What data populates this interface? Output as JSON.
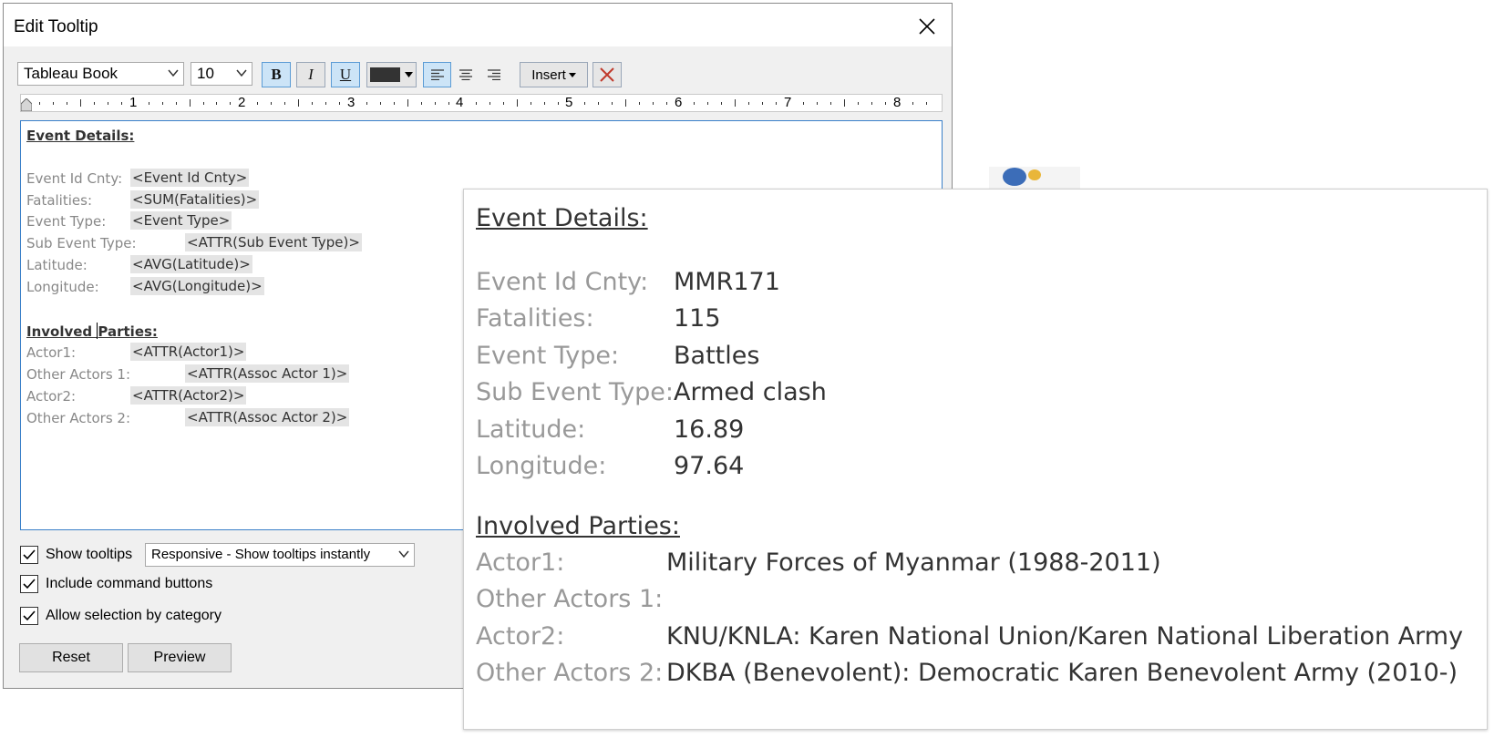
{
  "dialog": {
    "title": "Edit Tooltip",
    "toolbar": {
      "font_name": "Tableau Book",
      "font_size": "10",
      "bold_label": "B",
      "italic_label": "I",
      "underline_label": "U",
      "text_color": "#333333",
      "insert_label": "Insert"
    },
    "ruler_numbers": [
      "1",
      "2",
      "3",
      "4",
      "5",
      "6",
      "7",
      "8"
    ],
    "editor": {
      "heading1": "Event Details:",
      "rows1": [
        {
          "label": "Event Id Cnty:",
          "field": "<Event Id Cnty>"
        },
        {
          "label": "Fatalities:",
          "field": "<SUM(Fatalities)>"
        },
        {
          "label": "Event Type:",
          "field": "<Event Type>"
        },
        {
          "label": "Sub Event Type:",
          "field": "<ATTR(Sub Event Type)>"
        },
        {
          "label": "Latitude:",
          "field": "<AVG(Latitude)>"
        },
        {
          "label": "Longitude:",
          "field": "<AVG(Longitude)>"
        }
      ],
      "heading2_part1": "Involved ",
      "heading2_part2": "Parties:",
      "rows2": [
        {
          "label": "Actor1:",
          "field": "<ATTR(Actor1)>"
        },
        {
          "label": "Other Actors 1:",
          "field": "<ATTR(Assoc Actor 1)>"
        },
        {
          "label": "Actor2:",
          "field": "<ATTR(Actor2)>"
        },
        {
          "label": "Other Actors 2:",
          "field": "<ATTR(Assoc Actor 2)>"
        }
      ]
    },
    "options": {
      "show_tooltips": "Show tooltips",
      "show_tooltips_mode": "Responsive - Show tooltips instantly",
      "include_command_buttons": "Include command buttons",
      "allow_selection": "Allow selection by category"
    },
    "buttons": {
      "reset": "Reset",
      "preview": "Preview"
    }
  },
  "tooltip": {
    "heading1": "Event Details:",
    "rows1": [
      {
        "label": "Event Id Cnty:",
        "value": "MMR171"
      },
      {
        "label": "Fatalities:",
        "value": "115"
      },
      {
        "label": "Event Type:",
        "value": "Battles"
      },
      {
        "label": "Sub Event Type:",
        "value": "Armed clash"
      },
      {
        "label": "Latitude:",
        "value": "16.89"
      },
      {
        "label": "Longitude:",
        "value": "97.64"
      }
    ],
    "heading2": "Involved Parties:",
    "rows2": [
      {
        "label": "Actor1:",
        "value": "Military Forces of Myanmar (1988-2011)"
      },
      {
        "label": "Other Actors 1:",
        "value": ""
      },
      {
        "label": "Actor2:",
        "value": "KNU/KNLA: Karen National Union/Karen National Liberation Army"
      },
      {
        "label": "Other Actors 2:",
        "value": "DKBA (Benevolent): Democratic Karen Benevolent Army (2010-)"
      }
    ]
  }
}
